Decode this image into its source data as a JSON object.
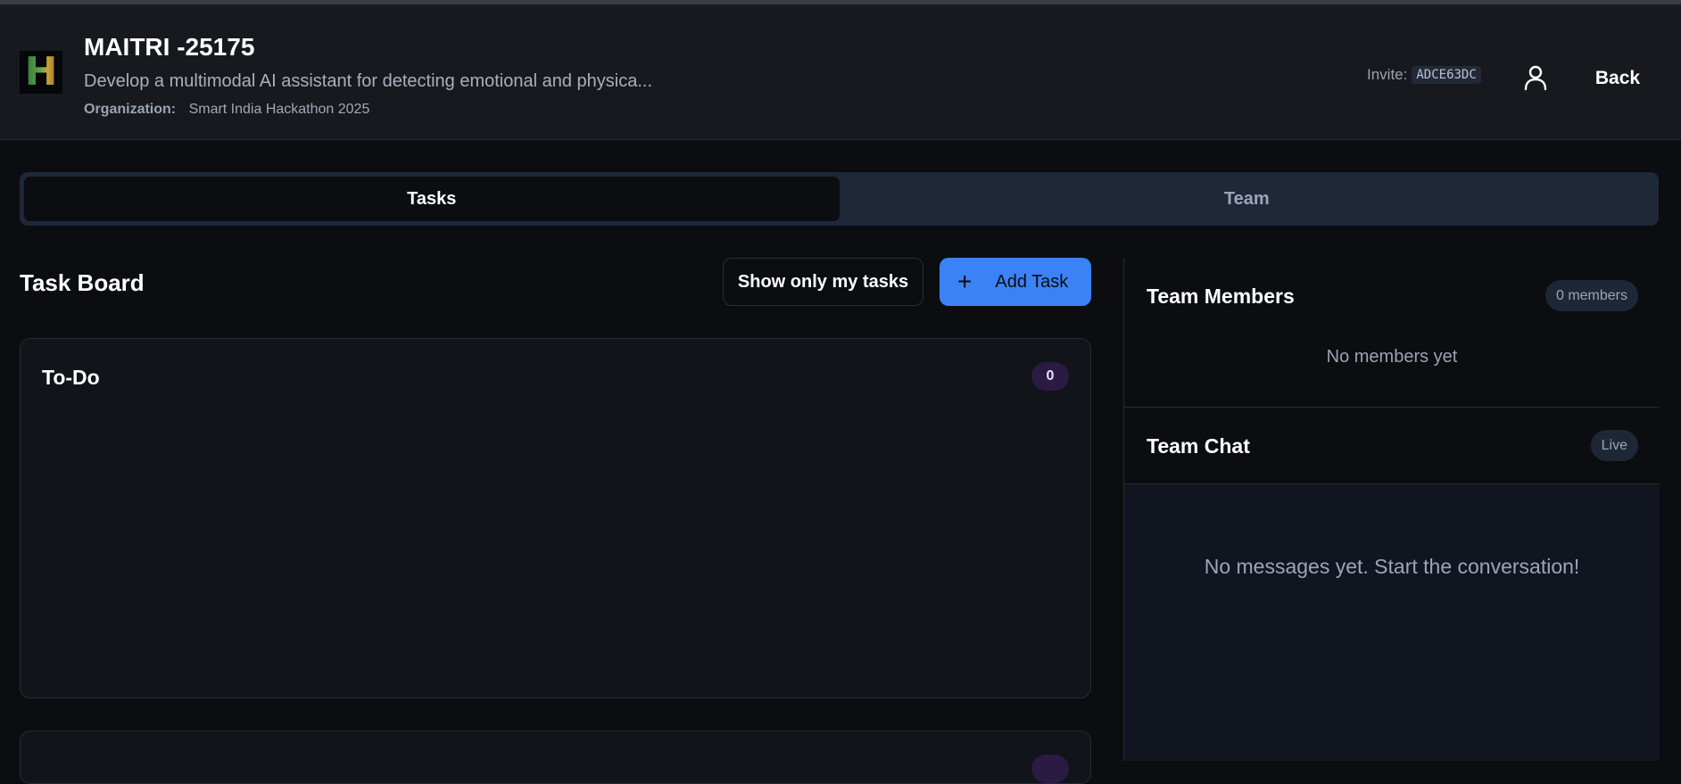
{
  "header": {
    "logo_letter": "H",
    "title": "MAITRI -25175",
    "subtitle": "Develop a multimodal AI assistant for detecting emotional and physica...",
    "organization_label": "Organization:",
    "organization_value": "Smart India Hackathon 2025",
    "invite_label": "Invite:",
    "invite_code": "ADCE63DC",
    "back_label": "Back"
  },
  "tabs": [
    {
      "label": "Tasks",
      "active": true
    },
    {
      "label": "Team",
      "active": false
    }
  ],
  "board": {
    "title": "Task Board",
    "filter_label": "Show only my tasks",
    "add_label": "Add Task",
    "columns": [
      {
        "title": "To-Do",
        "count": "0"
      }
    ]
  },
  "team": {
    "members_title": "Team Members",
    "members_badge": "0 members",
    "members_empty": "No members yet",
    "chat_title": "Team Chat",
    "chat_badge": "Live",
    "chat_empty": "No messages yet. Start the conversation!"
  },
  "colors": {
    "accent": "#3b82f6",
    "background": "#0b0d11",
    "header": "#17191e"
  }
}
